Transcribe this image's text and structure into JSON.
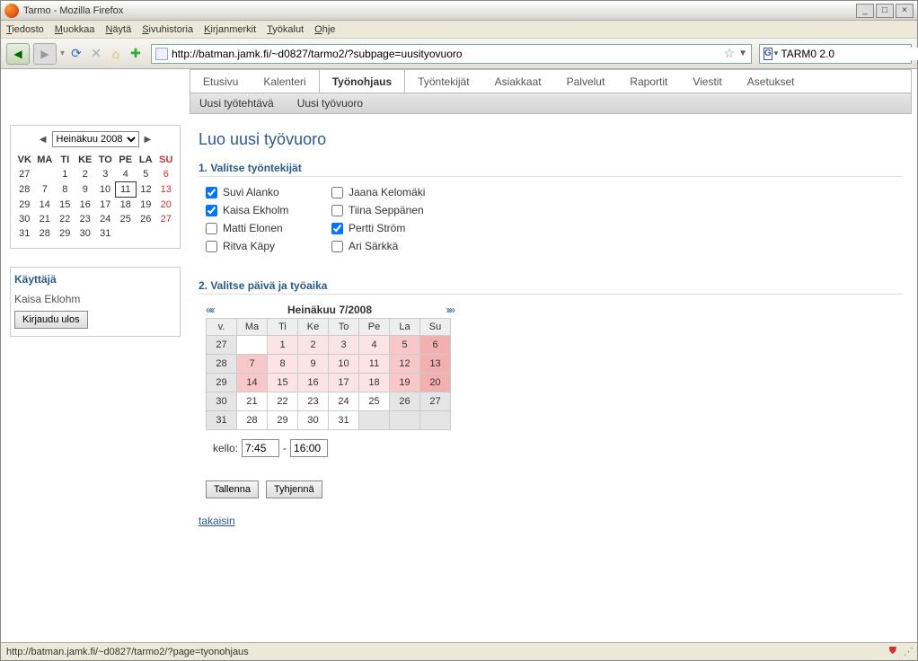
{
  "window": {
    "title": "Tarmo - Mozilla Firefox"
  },
  "menubar": [
    "Tiedosto",
    "Muokkaa",
    "Näytä",
    "Sivuhistoria",
    "Kirjanmerkit",
    "Työkalut",
    "Ohje"
  ],
  "url": "http://batman.jamk.fi/~d0827/tarmo2/?subpage=uusityovuoro",
  "search": {
    "placeholder": "TARM0 2.0"
  },
  "tabs": [
    "Etusivu",
    "Kalenteri",
    "Työnohjaus",
    "Työntekijät",
    "Asiakkaat",
    "Palvelut",
    "Raportit",
    "Viestit",
    "Asetukset"
  ],
  "subtabs": [
    "Uusi työtehtävä",
    "Uusi työvuoro"
  ],
  "sidebar": {
    "month_select": "Heinäkuu 2008",
    "headers": [
      "VK",
      "MA",
      "TI",
      "KE",
      "TO",
      "PE",
      "LA",
      "SU"
    ],
    "rows": [
      [
        "27",
        "",
        "1",
        "2",
        "3",
        "4",
        "5",
        "6"
      ],
      [
        "28",
        "7",
        "8",
        "9",
        "10",
        "11",
        "12",
        "13"
      ],
      [
        "29",
        "14",
        "15",
        "16",
        "17",
        "18",
        "19",
        "20"
      ],
      [
        "30",
        "21",
        "22",
        "23",
        "24",
        "25",
        "26",
        "27"
      ],
      [
        "31",
        "28",
        "29",
        "30",
        "31",
        "",
        "",
        ""
      ]
    ],
    "user_heading": "Käyttäjä",
    "user_name": "Kaisa Eklohm",
    "logout": "Kirjaudu ulos"
  },
  "page": {
    "title": "Luo uusi työvuoro",
    "sec1": "1. Valitse työntekijät",
    "emps": [
      {
        "name": "Suvi Alanko",
        "checked": true
      },
      {
        "name": "Jaana Kelomäki",
        "checked": false
      },
      {
        "name": "Kaisa Ekholm",
        "checked": true
      },
      {
        "name": "Tiina Seppänen",
        "checked": false
      },
      {
        "name": "Matti Elonen",
        "checked": false
      },
      {
        "name": "Pertti Ström",
        "checked": true
      },
      {
        "name": "Ritva Käpy",
        "checked": false
      },
      {
        "name": "Ari Särkkä",
        "checked": false
      }
    ],
    "sec2": "2. Valitse päivä ja työaika",
    "cal_label": "Heinäkuu 7/2008",
    "cal_headers": [
      "v.",
      "Ma",
      "Ti",
      "Ke",
      "To",
      "Pe",
      "La",
      "Su"
    ],
    "cal_rows": [
      {
        "wk": "27",
        "days": [
          {
            "n": "",
            "c": ""
          },
          {
            "n": "1",
            "c": "pnk1"
          },
          {
            "n": "2",
            "c": "pnk1"
          },
          {
            "n": "3",
            "c": "pnk1"
          },
          {
            "n": "4",
            "c": "pnk1"
          },
          {
            "n": "5",
            "c": "pnk2"
          },
          {
            "n": "6",
            "c": "pnk3"
          }
        ]
      },
      {
        "wk": "28",
        "days": [
          {
            "n": "7",
            "c": "pnk2"
          },
          {
            "n": "8",
            "c": "pnk1"
          },
          {
            "n": "9",
            "c": "pnk1"
          },
          {
            "n": "10",
            "c": "pnk1"
          },
          {
            "n": "11",
            "c": "pnk1"
          },
          {
            "n": "12",
            "c": "pnk2"
          },
          {
            "n": "13",
            "c": "pnk3"
          }
        ]
      },
      {
        "wk": "29",
        "days": [
          {
            "n": "14",
            "c": "pnk2"
          },
          {
            "n": "15",
            "c": "pnk1"
          },
          {
            "n": "16",
            "c": "pnk1"
          },
          {
            "n": "17",
            "c": "pnk1"
          },
          {
            "n": "18",
            "c": "pnk1"
          },
          {
            "n": "19",
            "c": "pnk2"
          },
          {
            "n": "20",
            "c": "pnk3"
          }
        ]
      },
      {
        "wk": "30",
        "days": [
          {
            "n": "21",
            "c": ""
          },
          {
            "n": "22",
            "c": ""
          },
          {
            "n": "23",
            "c": ""
          },
          {
            "n": "24",
            "c": ""
          },
          {
            "n": "25",
            "c": ""
          },
          {
            "n": "26",
            "c": "gy"
          },
          {
            "n": "27",
            "c": "gy"
          }
        ]
      },
      {
        "wk": "31",
        "days": [
          {
            "n": "28",
            "c": ""
          },
          {
            "n": "29",
            "c": ""
          },
          {
            "n": "30",
            "c": ""
          },
          {
            "n": "31",
            "c": ""
          },
          {
            "n": "",
            "c": "gy"
          },
          {
            "n": "",
            "c": "gy"
          },
          {
            "n": "",
            "c": "gy"
          }
        ]
      }
    ],
    "time_label": "kello:",
    "time_start": "7:45",
    "time_end": "16:00",
    "save": "Tallenna",
    "clear": "Tyhjennä",
    "back": "takaisin"
  },
  "status": "http://batman.jamk.fi/~d0827/tarmo2/?page=tyonohjaus"
}
